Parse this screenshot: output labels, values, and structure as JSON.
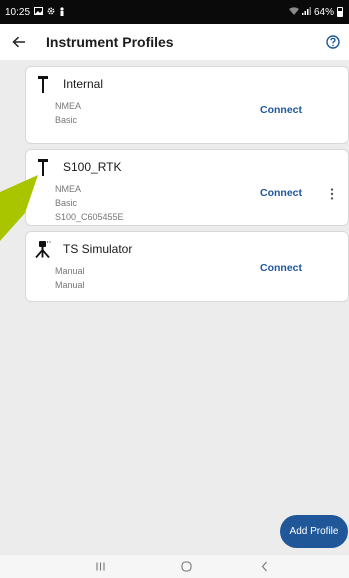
{
  "status_bar": {
    "time": "10:25",
    "battery": "64%",
    "left_icons": [
      "gallery-icon",
      "settings-icon",
      "person-icon"
    ],
    "right_icons": [
      "wifi-icon",
      "signal-icon",
      "battery-icon"
    ]
  },
  "header": {
    "title": "Instrument Profiles",
    "back_icon": "arrow-left-icon",
    "help_icon": "help-circle-icon"
  },
  "profiles": [
    {
      "name": "Internal",
      "lines": [
        "NMEA",
        "Basic"
      ],
      "action": "Connect",
      "icon": "gnss-pole-icon",
      "more": false
    },
    {
      "name": "S100_RTK",
      "lines": [
        "NMEA",
        "Basic",
        "S100_C605455E"
      ],
      "action": "Connect",
      "icon": "gnss-pole-icon",
      "more": true
    },
    {
      "name": "TS Simulator",
      "lines": [
        "Manual",
        "Manual"
      ],
      "action": "Connect",
      "icon": "total-station-icon",
      "more": false
    }
  ],
  "fab": {
    "label": "Add Profile"
  },
  "colors": {
    "accent": "#1f5799",
    "background": "#ececec",
    "pointer": "#a8c500",
    "status_bar": "#0a0a0a"
  },
  "nav_bar": [
    "recent-apps-icon",
    "home-icon",
    "back-icon"
  ]
}
